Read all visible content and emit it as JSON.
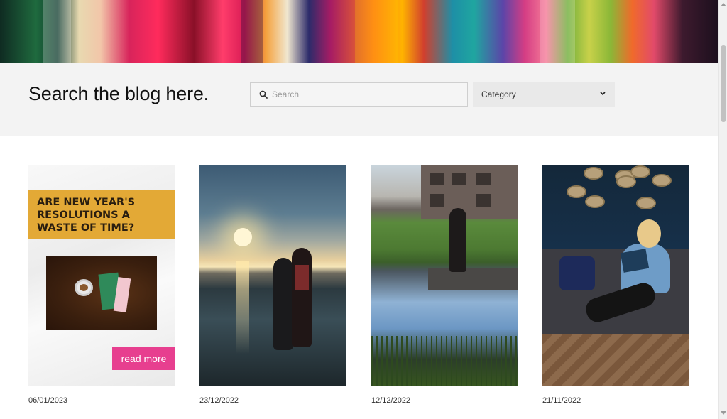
{
  "hero": {
    "alt": "colorful paint banner"
  },
  "search": {
    "title": "Search the blog here.",
    "placeholder": "Search",
    "value": "",
    "category_label": "Category"
  },
  "posts": [
    {
      "date": "06/01/2023",
      "headline": "ARE NEW YEAR'S RESOLUTIONS A WASTE OF TIME?",
      "cta": "read more"
    },
    {
      "date": "23/12/2022"
    },
    {
      "date": "12/12/2022"
    },
    {
      "date": "21/11/2022"
    }
  ],
  "colors": {
    "accent_pink": "#e73f8f",
    "banner_gold": "#e3a936",
    "band_bg": "#f3f3f3"
  },
  "icons": [
    "search-icon",
    "chevron-down-icon"
  ]
}
